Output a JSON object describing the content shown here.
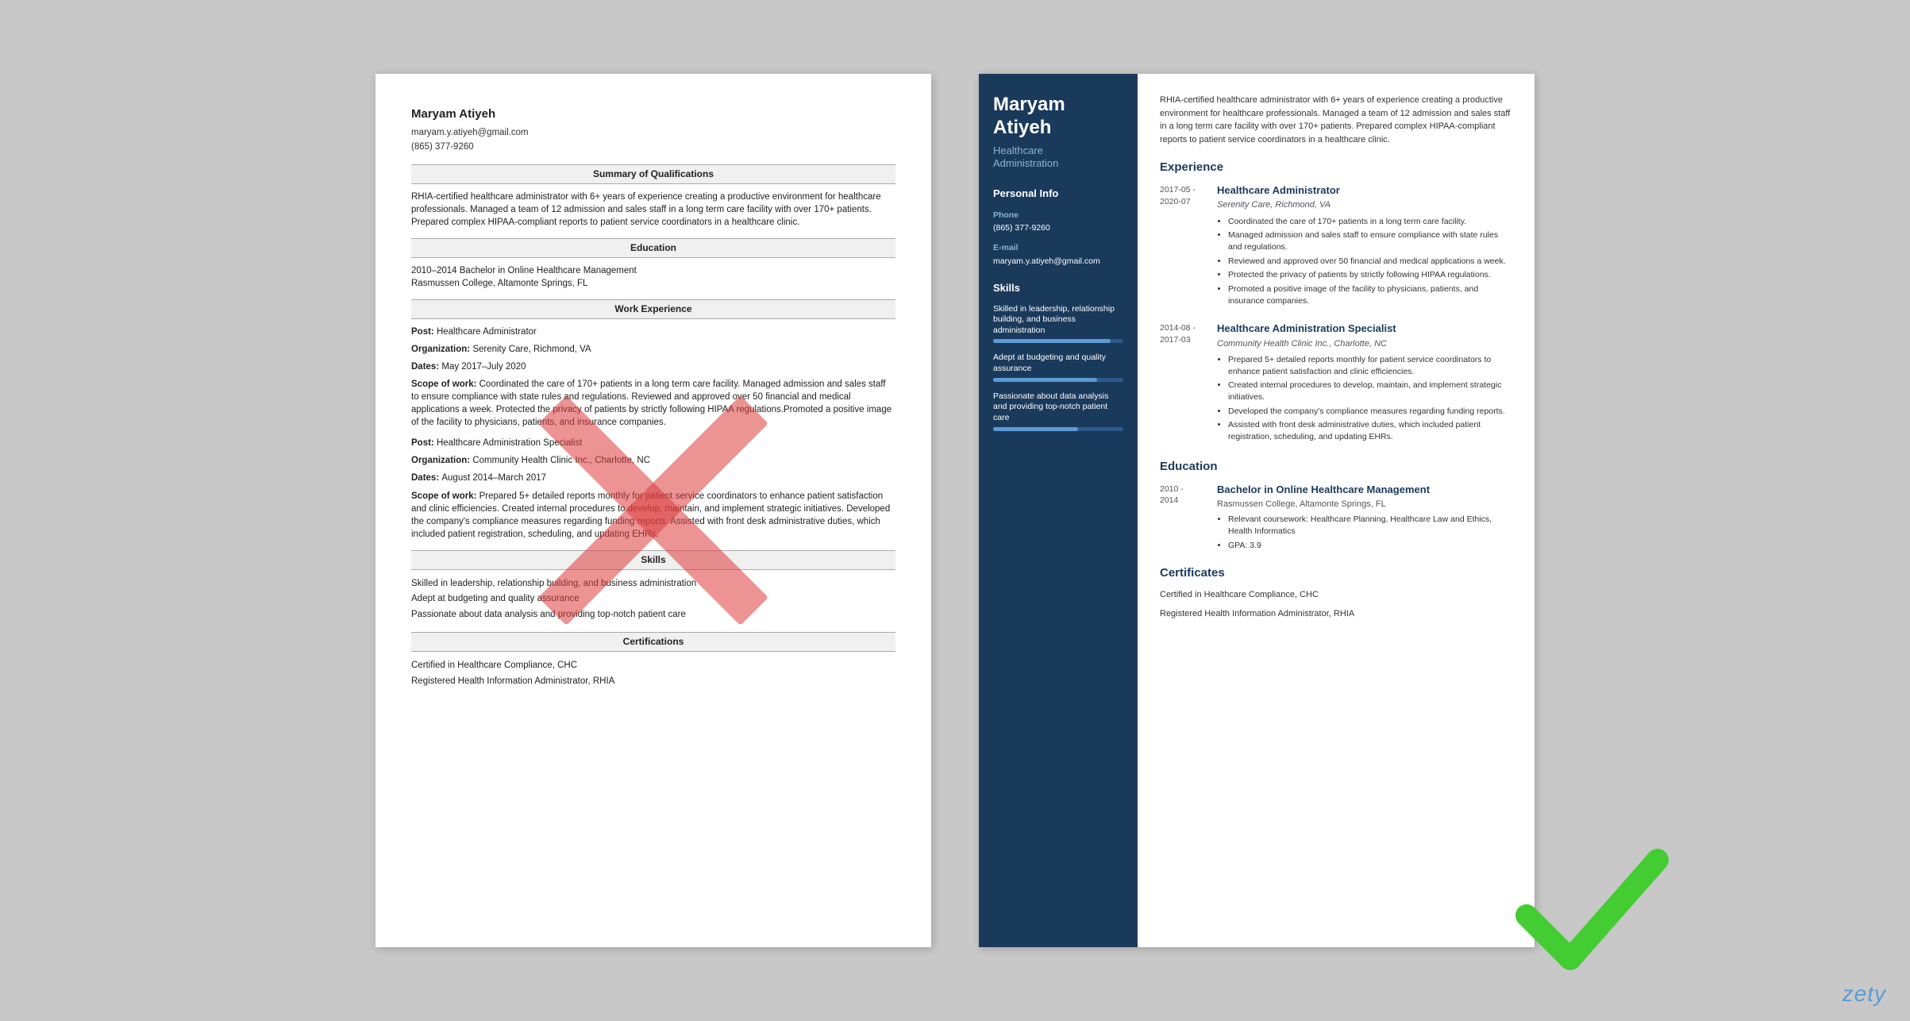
{
  "bad_resume": {
    "name": "Maryam Atiyeh",
    "email": "maryam.y.atiyeh@gmail.com",
    "phone": "(865) 377-9260",
    "sections": {
      "summary_header": "Summary of Qualifications",
      "summary": "RHIA-certified healthcare administrator with 6+ years of experience creating a productive environment for healthcare professionals. Managed a team of 12 admission and sales staff in a long term care facility with over 170+ patients. Prepared complex HIPAA-compliant reports to patient service coordinators in a healthcare clinic.",
      "education_header": "Education",
      "education": "2010–2014 Bachelor in Online Healthcare Management\nRasmussen College, Altamonte Springs, FL",
      "work_header": "Work Experience",
      "work": [
        {
          "post_label": "Post:",
          "post": "Healthcare Administrator",
          "org_label": "Organization:",
          "org": "Serenity Care, Richmond, VA",
          "date_label": "Dates:",
          "date": "May 2017–July 2020",
          "scope_label": "Scope of work:",
          "scope": "Coordinated the care of 170+ patients in a long term care facility. Managed admission and sales staff to ensure compliance with state rules and regulations.  Reviewed and approved over 50 financial and medical applications a week. Protected the privacy of patients by strictly following HIPAA regulations.Promoted a positive image of the facility to physicians, patients, and insurance companies."
        },
        {
          "post_label": "Post:",
          "post": "Healthcare Administration Specialist",
          "org_label": "Organization:",
          "org": "Community Health Clinic Inc., Charlotte, NC",
          "date_label": "Dates:",
          "date": "August 2014–March 2017",
          "scope_label": "Scope of work:",
          "scope": "Prepared 5+ detailed reports monthly for patient service coordinators to enhance patient satisfaction and clinic efficiencies. Created internal procedures to develop, maintain, and implement strategic initiatives. Developed the company's compliance measures regarding funding reports. Assisted with front desk administrative duties, which included patient registration, scheduling, and updating EHRs."
        }
      ],
      "skills_header": "Skills",
      "skills": [
        "Skilled in leadership, relationship building, and business administration",
        "Adept at budgeting and quality assurance",
        "Passionate about data analysis and providing top-notch patient care"
      ],
      "certs_header": "Certifications",
      "certs": [
        "Certified in Healthcare Compliance, CHC",
        "Registered Health Information Administrator, RHIA"
      ]
    }
  },
  "good_resume": {
    "sidebar": {
      "name": "Maryam\nAtiyeh",
      "title": "Healthcare\nAdministration",
      "personal_info_title": "Personal Info",
      "phone_label": "Phone",
      "phone": "(865) 377-9260",
      "email_label": "E-mail",
      "email": "maryam.y.atiyeh@gmail.com",
      "skills_title": "Skills",
      "skills": [
        {
          "text": "Skilled in leadership, relationship building, and business administration",
          "percent": 90
        },
        {
          "text": "Adept at budgeting and quality assurance",
          "percent": 80
        },
        {
          "text": "Passionate about data analysis and providing top-notch patient care",
          "percent": 70
        }
      ]
    },
    "main": {
      "summary": "RHIA-certified healthcare administrator with 6+ years of experience creating a productive environment for healthcare professionals. Managed a team of 12 admission and sales staff in a long term care facility with over 170+ patients. Prepared complex HIPAA-compliant reports to patient service coordinators in a healthcare clinic.",
      "experience_title": "Experience",
      "experience": [
        {
          "date": "2017-05 -\n2020-07",
          "title": "Healthcare Administrator",
          "company": "Serenity Care, Richmond, VA",
          "bullets": [
            "Coordinated the care of 170+ patients in a long term care facility.",
            "Managed admission and sales staff to ensure compliance with state rules and regulations.",
            "Reviewed and approved over 50 financial and medical applications a week.",
            "Protected the privacy of patients by strictly following HIPAA regulations.",
            "Promoted a positive image of the facility to physicians, patients, and insurance companies."
          ]
        },
        {
          "date": "2014-08 -\n2017-03",
          "title": "Healthcare Administration Specialist",
          "company": "Community Health Clinic Inc., Charlotte, NC",
          "bullets": [
            "Prepared 5+ detailed reports monthly for patient service coordinators to enhance patient satisfaction and clinic efficiencies.",
            "Created internal procedures to develop, maintain, and implement strategic initiatives.",
            "Developed the company's compliance measures regarding funding reports.",
            "Assisted with front desk administrative duties, which included patient registration, scheduling, and updating EHRs."
          ]
        }
      ],
      "education_title": "Education",
      "education": [
        {
          "date": "2010 -\n2014",
          "degree": "Bachelor in Online Healthcare Management",
          "school": "Rasmussen College, Altamonte Springs, FL",
          "bullets": [
            "Relevant coursework: Healthcare Planning, Healthcare Law and Ethics, Health Informatics",
            "GPA: 3.9"
          ]
        }
      ],
      "certs_title": "Certificates",
      "certs": [
        "Certified in Healthcare Compliance, CHC",
        "Registered Health Information Administrator, RHIA"
      ]
    }
  },
  "watermark": "zety"
}
